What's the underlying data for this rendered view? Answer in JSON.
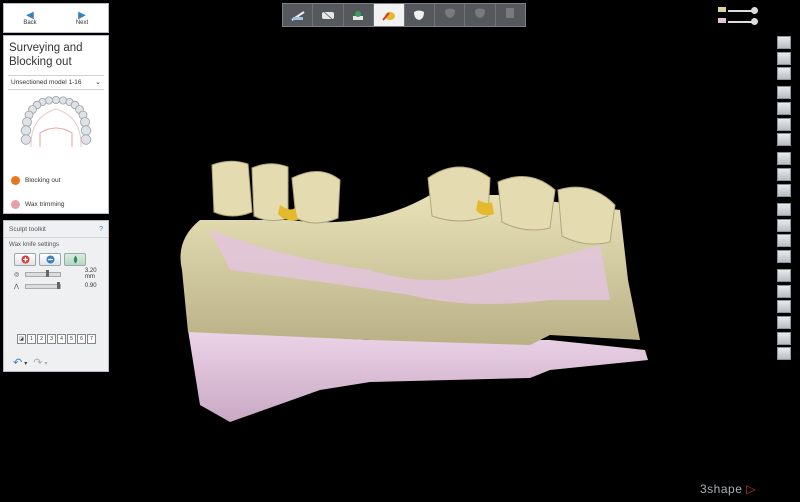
{
  "nav": {
    "back_label": "Back",
    "next_label": "Next"
  },
  "wizard": {
    "title": "Surveying and Blocking out",
    "model_select": "Unsectioned model 1-16",
    "steps": [
      {
        "label": "Blocking out",
        "icon": "blocking-out-icon",
        "color": "#e8761e"
      },
      {
        "label": "Wax trimming",
        "icon": "wax-trimming-icon",
        "color": "#e2a0a8"
      }
    ]
  },
  "sculpt": {
    "title": "Sculpt toolkit",
    "help": "?",
    "subtitle": "Wax knife settings",
    "knife_buttons": [
      "add-wax-icon",
      "smooth-wax-icon",
      "remove-wax-icon"
    ],
    "radius_value": "3.20 mm",
    "strength_value": "0.90",
    "numbers": [
      "1",
      "2",
      "3",
      "4",
      "5",
      "6",
      "7"
    ]
  },
  "toolbar": {
    "items": [
      "model-prep-icon",
      "survey-icon",
      "blockout-step-icon",
      "sculpt-icon",
      "tooth-icon",
      "disabled-icon-1",
      "disabled-icon-2",
      "disabled-icon-3"
    ],
    "active_index": 3
  },
  "brand": {
    "logo": "3shape",
    "accent": "#c0392b"
  },
  "colors": {
    "model_gum": "#e3c4de",
    "model_stone": "#dbd3a4",
    "wax_yellow": "#e4b92b"
  }
}
